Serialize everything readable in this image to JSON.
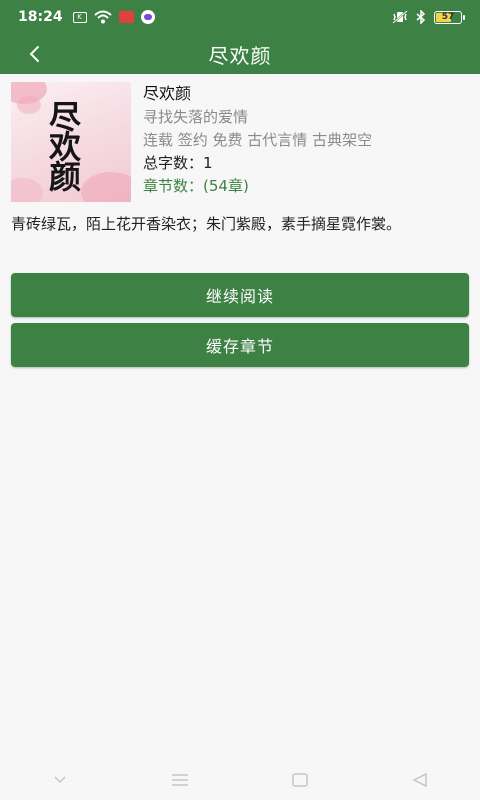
{
  "status_bar": {
    "time": "18:24",
    "battery_level": "57",
    "battery_fraction": 0.57,
    "icons": [
      "k-app-icon",
      "wifi-icon",
      "red-app-icon",
      "chat-app-icon",
      "vibrate-icon",
      "bluetooth-icon",
      "battery-icon"
    ]
  },
  "header": {
    "title": "尽欢颜",
    "back_icon": "chevron-left-icon"
  },
  "book": {
    "cover_text": "尽欢颜",
    "title": "尽欢颜",
    "subtitle": "寻找失落的爱情",
    "tags": "连载 签约 免费 古代言情 古典架空",
    "word_count": "总字数：1",
    "chapter_count": "章节数：(54章)",
    "description": "青砖绿瓦，陌上花开香染衣；朱门紫殿，素手摘星霓作裳。"
  },
  "actions": {
    "continue_reading": "继续阅读",
    "cache_chapters": "缓存章节"
  },
  "nav_bar": {
    "icons": [
      "chevron-down-icon",
      "menu-icon",
      "home-icon",
      "back-triangle-icon"
    ]
  },
  "colors": {
    "primary": "#3d8244",
    "chapter_text": "#3d8244",
    "muted_text": "#8a8a8a",
    "background": "#f7f7f7"
  }
}
